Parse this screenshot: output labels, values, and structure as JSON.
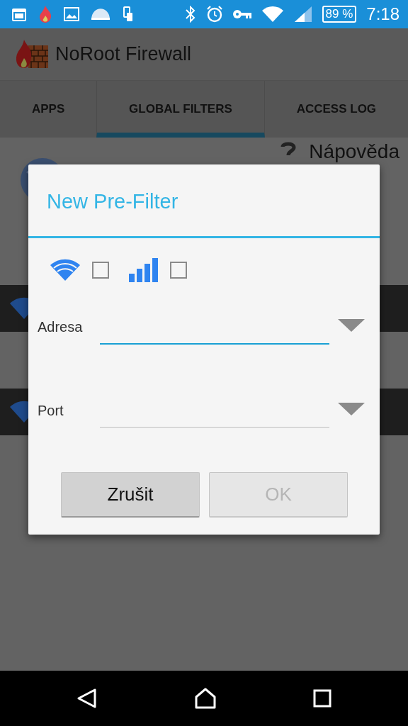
{
  "status_bar": {
    "battery": "89 %",
    "time": "7:18"
  },
  "app_bar": {
    "title": "NoRoot Firewall"
  },
  "tabs": [
    {
      "label": "APPS",
      "selected": false
    },
    {
      "label": "GLOBAL FILTERS",
      "selected": true
    },
    {
      "label": "ACCESS LOG",
      "selected": false
    }
  ],
  "background": {
    "help_label": "Nápověda"
  },
  "dialog": {
    "title": "New Pre-Filter",
    "network_options": [
      {
        "kind": "wifi",
        "checked": false
      },
      {
        "kind": "mobile",
        "checked": false
      }
    ],
    "fields": [
      {
        "label": "Adresa",
        "focused": true
      },
      {
        "label": "Port",
        "focused": false
      }
    ],
    "buttons": [
      {
        "label": "Zrušit",
        "disabled": false
      },
      {
        "label": "OK",
        "disabled": true
      }
    ]
  }
}
